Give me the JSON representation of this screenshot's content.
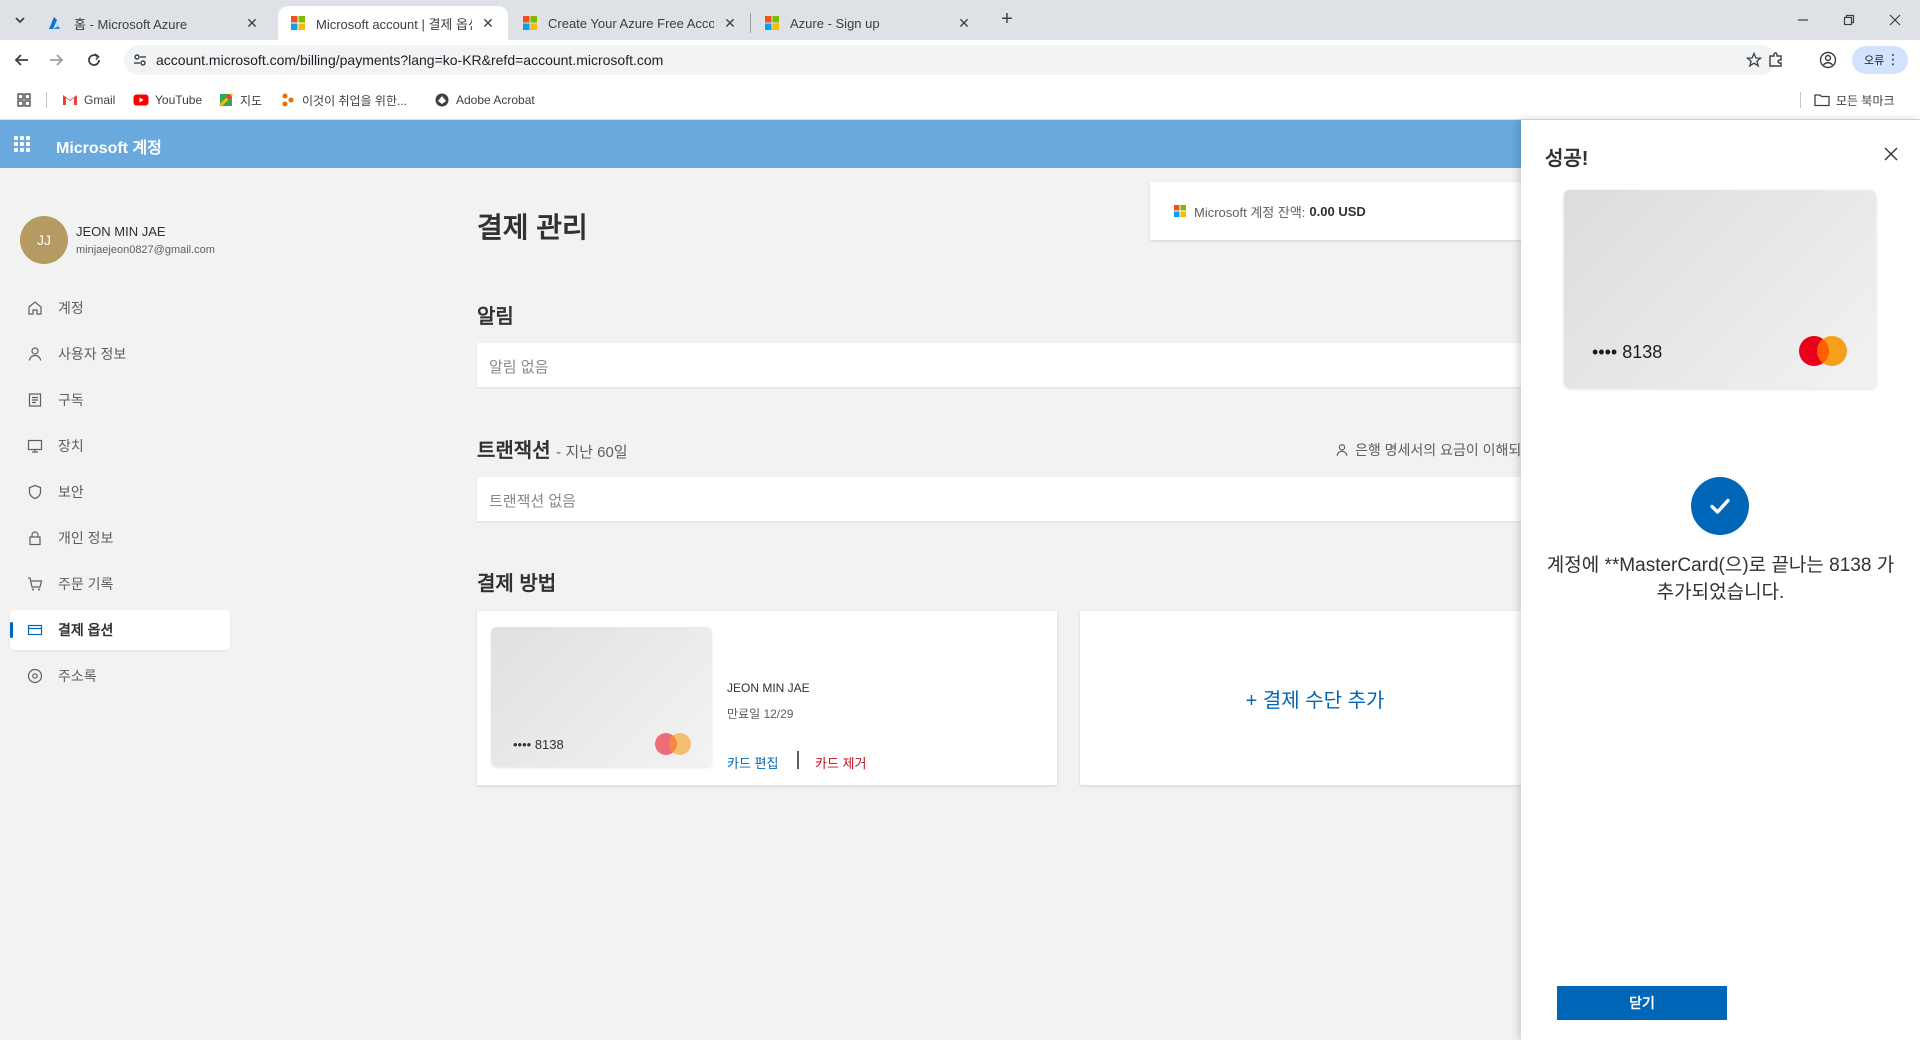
{
  "browser": {
    "tabs": [
      {
        "title": "홈 - Microsoft Azure",
        "active": false
      },
      {
        "title": "Microsoft account | 결제 옵션",
        "active": true
      },
      {
        "title": "Create Your Azure Free Accoun",
        "active": false
      },
      {
        "title": "Azure - Sign up",
        "active": false
      }
    ],
    "url": "account.microsoft.com/billing/payments?lang=ko-KR&refd=account.microsoft.com",
    "profile_label": "오류",
    "bookmarks": [
      "Gmail",
      "YouTube",
      "지도",
      "이것이 취업을 위한...",
      "Adobe Acrobat"
    ],
    "all_bookmarks": "모든 북마크"
  },
  "header": {
    "title": "Microsoft 계정"
  },
  "user": {
    "initials": "JJ",
    "name": "JEON MIN JAE",
    "email": "minjaejeon0827@gmail.com"
  },
  "nav": [
    {
      "label": "계정",
      "icon": "home-icon"
    },
    {
      "label": "사용자 정보",
      "icon": "person-icon"
    },
    {
      "label": "구독",
      "icon": "subscription-icon"
    },
    {
      "label": "장치",
      "icon": "device-icon"
    },
    {
      "label": "보안",
      "icon": "shield-icon"
    },
    {
      "label": "개인 정보",
      "icon": "lock-icon"
    },
    {
      "label": "주문 기록",
      "icon": "cart-icon"
    },
    {
      "label": "결제 옵션",
      "icon": "card-icon",
      "active": true
    },
    {
      "label": "주소록",
      "icon": "location-icon"
    }
  ],
  "main": {
    "title": "결제 관리",
    "balance_label": "Microsoft 계정 잔액:",
    "balance_value": "0.00 USD",
    "alerts_heading": "알림",
    "alerts_empty": "알림 없음",
    "transactions_heading": "트랜잭션",
    "transactions_sub": "- 지난 60일",
    "bank_note": "은행 명세서의 요금이 이해되",
    "transactions_empty": "트랜잭션 없음",
    "payment_heading": "결제 방법",
    "card": {
      "digits": "•••• 8138",
      "holder": "JEON MIN JAE",
      "expiry": "만료일 12/29",
      "edit": "카드 편집",
      "remove": "카드 제거"
    },
    "add_payment": "+ 결제 수단 추가"
  },
  "panel": {
    "title": "성공!",
    "card_digits": "•••• 8138",
    "message": "계정에 **MasterCard(으)로 끝나는 8138 가 추가되었습니다.",
    "close_button": "닫기"
  },
  "colors": {
    "accent": "#0067b8",
    "header": "#69a9dd",
    "remove": "#c50f1f",
    "mc_red": "#eb001b",
    "mc_orange": "#f79e1b"
  }
}
